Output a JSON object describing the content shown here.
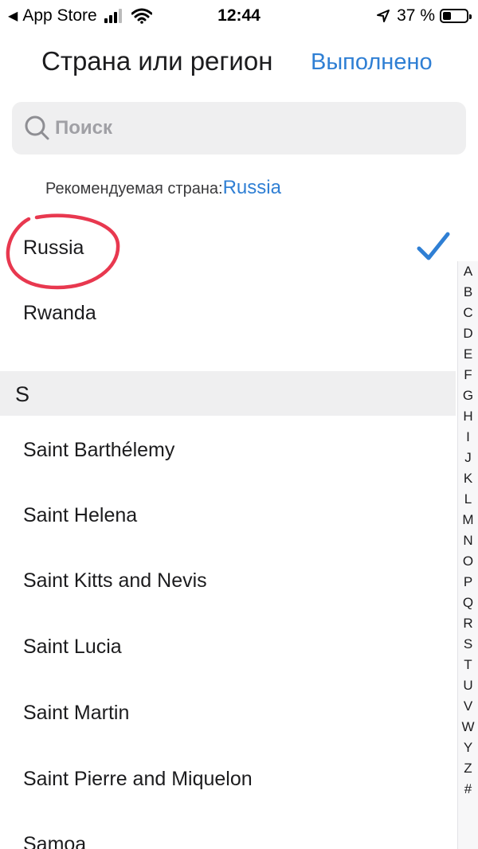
{
  "status_bar": {
    "back_app": "App Store",
    "time": "12:44",
    "battery": "37 %",
    "battery_level": 0.37
  },
  "nav": {
    "title": "Страна или регион",
    "done": "Выполнено"
  },
  "search": {
    "placeholder": "Поиск"
  },
  "recommended": {
    "label": "Рекомендуемая страна:",
    "value": "Russia"
  },
  "countries_top": [
    {
      "label": "Russia",
      "selected": true
    },
    {
      "label": "Rwanda",
      "selected": false
    }
  ],
  "section": {
    "letter": "S",
    "items": [
      "Saint Barthélemy",
      "Saint Helena",
      "Saint Kitts and Nevis",
      "Saint Lucia",
      "Saint Martin",
      "Saint Pierre and Miquelon",
      "Samoa"
    ]
  },
  "index": [
    "A",
    "B",
    "C",
    "D",
    "E",
    "F",
    "G",
    "H",
    "I",
    "J",
    "K",
    "L",
    "M",
    "N",
    "O",
    "P",
    "Q",
    "R",
    "S",
    "T",
    "U",
    "V",
    "W",
    "Y",
    "Z",
    "#"
  ],
  "colors": {
    "accent": "#2f7fd4",
    "annotation": "#e8384f"
  }
}
